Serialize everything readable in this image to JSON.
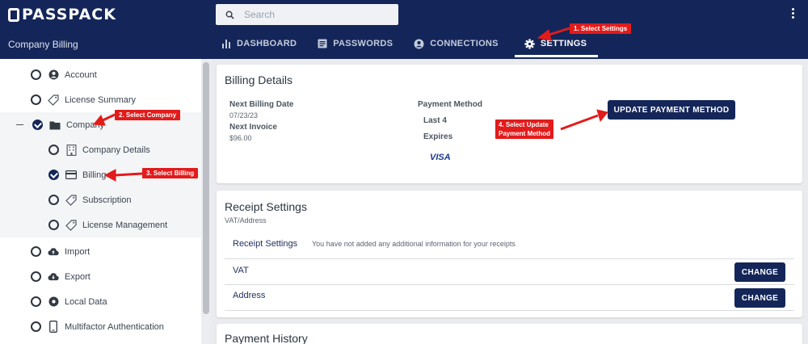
{
  "app": {
    "logo_text": "PASSPACK",
    "context_title": "Company Billing"
  },
  "search": {
    "placeholder": "Search"
  },
  "nav": {
    "tabs": [
      {
        "label": "DASHBOARD",
        "icon": "bar-chart-icon"
      },
      {
        "label": "PASSWORDS",
        "icon": "document-icon"
      },
      {
        "label": "CONNECTIONS",
        "icon": "person-circle-icon"
      },
      {
        "label": "SETTINGS",
        "icon": "gear-icon",
        "active": true
      }
    ]
  },
  "sidebar": {
    "items": [
      {
        "label": "Account",
        "icon": "user-circle-icon",
        "checked": false
      },
      {
        "label": "License Summary",
        "icon": "tag-icon",
        "checked": false
      },
      {
        "label": "Company",
        "icon": "folder-icon",
        "checked": true,
        "expanded": true
      },
      {
        "label": "Company Details",
        "icon": "building-icon",
        "checked": false
      },
      {
        "label": "Billing",
        "icon": "credit-card-icon",
        "checked": true
      },
      {
        "label": "Subscription",
        "icon": "tag-icon",
        "checked": false
      },
      {
        "label": "License Management",
        "icon": "tag-icon",
        "checked": false
      },
      {
        "label": "Import",
        "icon": "cloud-upload-icon",
        "checked": false
      },
      {
        "label": "Export",
        "icon": "cloud-download-icon",
        "checked": false
      },
      {
        "label": "Local Data",
        "icon": "local-data-icon",
        "checked": false
      },
      {
        "label": "Multifactor Authentication",
        "icon": "phone-icon",
        "checked": false
      }
    ]
  },
  "billing": {
    "title": "Billing Details",
    "next_billing_date_label": "Next Billing Date",
    "next_billing_date": "07/23/23",
    "next_invoice_label": "Next Invoice",
    "next_invoice": "$96.00",
    "payment_method_label": "Payment Method",
    "last4_label": "Last 4",
    "expires_label": "Expires",
    "card_brand": "VISA",
    "update_button": "UPDATE PAYMENT METHOD"
  },
  "receipt": {
    "title": "Receipt Settings",
    "subtitle": "VAT/Address",
    "row_label": "Receipt Settings",
    "row_text": "You have not added any additional information for your receipts",
    "vat_label": "VAT",
    "address_label": "Address",
    "change_label": "CHANGE"
  },
  "payment_history": {
    "title": "Payment History"
  },
  "annotations": {
    "step1": "1. Select Settings",
    "step2": "2. Select Company",
    "step3": "3. Select Billing",
    "step4_line1": "4. Select Update",
    "step4_line2": "Payment Method"
  },
  "colors": {
    "brand": "#142659",
    "callout": "#e21b1b"
  }
}
